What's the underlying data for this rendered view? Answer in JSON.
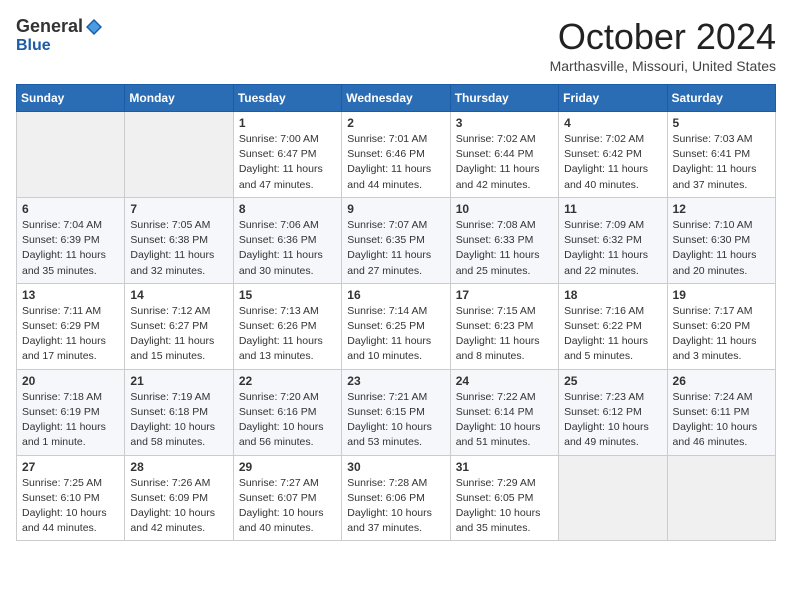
{
  "header": {
    "logo_general": "General",
    "logo_blue": "Blue",
    "month_title": "October 2024",
    "location": "Marthasville, Missouri, United States"
  },
  "weekdays": [
    "Sunday",
    "Monday",
    "Tuesday",
    "Wednesday",
    "Thursday",
    "Friday",
    "Saturday"
  ],
  "weeks": [
    [
      {
        "day": null
      },
      {
        "day": null
      },
      {
        "day": "1",
        "sunrise": "Sunrise: 7:00 AM",
        "sunset": "Sunset: 6:47 PM",
        "daylight": "Daylight: 11 hours and 47 minutes."
      },
      {
        "day": "2",
        "sunrise": "Sunrise: 7:01 AM",
        "sunset": "Sunset: 6:46 PM",
        "daylight": "Daylight: 11 hours and 44 minutes."
      },
      {
        "day": "3",
        "sunrise": "Sunrise: 7:02 AM",
        "sunset": "Sunset: 6:44 PM",
        "daylight": "Daylight: 11 hours and 42 minutes."
      },
      {
        "day": "4",
        "sunrise": "Sunrise: 7:02 AM",
        "sunset": "Sunset: 6:42 PM",
        "daylight": "Daylight: 11 hours and 40 minutes."
      },
      {
        "day": "5",
        "sunrise": "Sunrise: 7:03 AM",
        "sunset": "Sunset: 6:41 PM",
        "daylight": "Daylight: 11 hours and 37 minutes."
      }
    ],
    [
      {
        "day": "6",
        "sunrise": "Sunrise: 7:04 AM",
        "sunset": "Sunset: 6:39 PM",
        "daylight": "Daylight: 11 hours and 35 minutes."
      },
      {
        "day": "7",
        "sunrise": "Sunrise: 7:05 AM",
        "sunset": "Sunset: 6:38 PM",
        "daylight": "Daylight: 11 hours and 32 minutes."
      },
      {
        "day": "8",
        "sunrise": "Sunrise: 7:06 AM",
        "sunset": "Sunset: 6:36 PM",
        "daylight": "Daylight: 11 hours and 30 minutes."
      },
      {
        "day": "9",
        "sunrise": "Sunrise: 7:07 AM",
        "sunset": "Sunset: 6:35 PM",
        "daylight": "Daylight: 11 hours and 27 minutes."
      },
      {
        "day": "10",
        "sunrise": "Sunrise: 7:08 AM",
        "sunset": "Sunset: 6:33 PM",
        "daylight": "Daylight: 11 hours and 25 minutes."
      },
      {
        "day": "11",
        "sunrise": "Sunrise: 7:09 AM",
        "sunset": "Sunset: 6:32 PM",
        "daylight": "Daylight: 11 hours and 22 minutes."
      },
      {
        "day": "12",
        "sunrise": "Sunrise: 7:10 AM",
        "sunset": "Sunset: 6:30 PM",
        "daylight": "Daylight: 11 hours and 20 minutes."
      }
    ],
    [
      {
        "day": "13",
        "sunrise": "Sunrise: 7:11 AM",
        "sunset": "Sunset: 6:29 PM",
        "daylight": "Daylight: 11 hours and 17 minutes."
      },
      {
        "day": "14",
        "sunrise": "Sunrise: 7:12 AM",
        "sunset": "Sunset: 6:27 PM",
        "daylight": "Daylight: 11 hours and 15 minutes."
      },
      {
        "day": "15",
        "sunrise": "Sunrise: 7:13 AM",
        "sunset": "Sunset: 6:26 PM",
        "daylight": "Daylight: 11 hours and 13 minutes."
      },
      {
        "day": "16",
        "sunrise": "Sunrise: 7:14 AM",
        "sunset": "Sunset: 6:25 PM",
        "daylight": "Daylight: 11 hours and 10 minutes."
      },
      {
        "day": "17",
        "sunrise": "Sunrise: 7:15 AM",
        "sunset": "Sunset: 6:23 PM",
        "daylight": "Daylight: 11 hours and 8 minutes."
      },
      {
        "day": "18",
        "sunrise": "Sunrise: 7:16 AM",
        "sunset": "Sunset: 6:22 PM",
        "daylight": "Daylight: 11 hours and 5 minutes."
      },
      {
        "day": "19",
        "sunrise": "Sunrise: 7:17 AM",
        "sunset": "Sunset: 6:20 PM",
        "daylight": "Daylight: 11 hours and 3 minutes."
      }
    ],
    [
      {
        "day": "20",
        "sunrise": "Sunrise: 7:18 AM",
        "sunset": "Sunset: 6:19 PM",
        "daylight": "Daylight: 11 hours and 1 minute."
      },
      {
        "day": "21",
        "sunrise": "Sunrise: 7:19 AM",
        "sunset": "Sunset: 6:18 PM",
        "daylight": "Daylight: 10 hours and 58 minutes."
      },
      {
        "day": "22",
        "sunrise": "Sunrise: 7:20 AM",
        "sunset": "Sunset: 6:16 PM",
        "daylight": "Daylight: 10 hours and 56 minutes."
      },
      {
        "day": "23",
        "sunrise": "Sunrise: 7:21 AM",
        "sunset": "Sunset: 6:15 PM",
        "daylight": "Daylight: 10 hours and 53 minutes."
      },
      {
        "day": "24",
        "sunrise": "Sunrise: 7:22 AM",
        "sunset": "Sunset: 6:14 PM",
        "daylight": "Daylight: 10 hours and 51 minutes."
      },
      {
        "day": "25",
        "sunrise": "Sunrise: 7:23 AM",
        "sunset": "Sunset: 6:12 PM",
        "daylight": "Daylight: 10 hours and 49 minutes."
      },
      {
        "day": "26",
        "sunrise": "Sunrise: 7:24 AM",
        "sunset": "Sunset: 6:11 PM",
        "daylight": "Daylight: 10 hours and 46 minutes."
      }
    ],
    [
      {
        "day": "27",
        "sunrise": "Sunrise: 7:25 AM",
        "sunset": "Sunset: 6:10 PM",
        "daylight": "Daylight: 10 hours and 44 minutes."
      },
      {
        "day": "28",
        "sunrise": "Sunrise: 7:26 AM",
        "sunset": "Sunset: 6:09 PM",
        "daylight": "Daylight: 10 hours and 42 minutes."
      },
      {
        "day": "29",
        "sunrise": "Sunrise: 7:27 AM",
        "sunset": "Sunset: 6:07 PM",
        "daylight": "Daylight: 10 hours and 40 minutes."
      },
      {
        "day": "30",
        "sunrise": "Sunrise: 7:28 AM",
        "sunset": "Sunset: 6:06 PM",
        "daylight": "Daylight: 10 hours and 37 minutes."
      },
      {
        "day": "31",
        "sunrise": "Sunrise: 7:29 AM",
        "sunset": "Sunset: 6:05 PM",
        "daylight": "Daylight: 10 hours and 35 minutes."
      },
      {
        "day": null
      },
      {
        "day": null
      }
    ]
  ]
}
